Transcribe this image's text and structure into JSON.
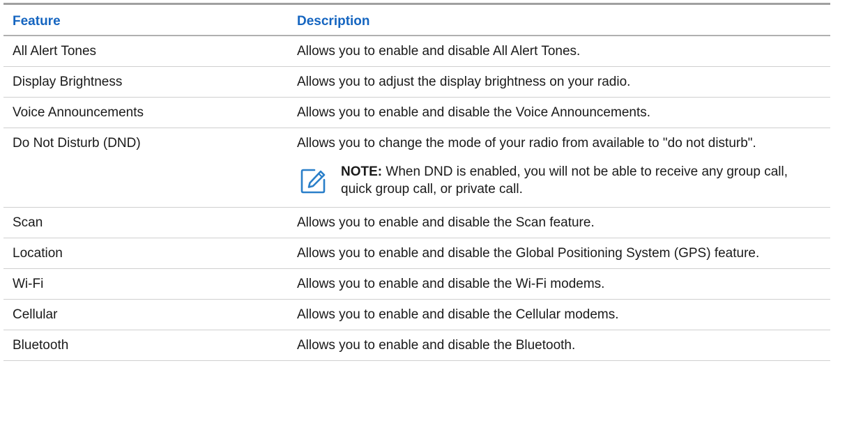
{
  "table": {
    "headers": {
      "feature": "Feature",
      "description": "Description"
    },
    "rows": [
      {
        "feature": "All Alert Tones",
        "description": "Allows you to enable and disable All Alert Tones."
      },
      {
        "feature": "Display Brightness",
        "description": "Allows you to adjust the display brightness on your radio."
      },
      {
        "feature": "Voice Announcements",
        "description": "Allows you to enable and disable the Voice Announcements."
      },
      {
        "feature": "Do Not Disturb (DND)",
        "description": "Allows you to change the mode of your radio from available to \"do not disturb\".",
        "note": {
          "label": "NOTE:",
          "text": " When DND is enabled, you will not be able to receive any group call, quick group call, or private call.",
          "icon": "pencil-note-icon"
        }
      },
      {
        "feature": "Scan",
        "description": "Allows you to enable and disable the Scan feature."
      },
      {
        "feature": "Location",
        "description": "Allows you to enable and disable the Global Positioning System (GPS) feature."
      },
      {
        "feature": "Wi-Fi",
        "description": "Allows you to enable and disable the Wi-Fi modems."
      },
      {
        "feature": "Cellular",
        "description": "Allows you to enable and disable the Cellular modems."
      },
      {
        "feature": "Bluetooth",
        "description": "Allows you to enable and disable the Bluetooth."
      }
    ]
  },
  "colors": {
    "header_text": "#1565c0",
    "note_icon": "#2a7fc9"
  }
}
